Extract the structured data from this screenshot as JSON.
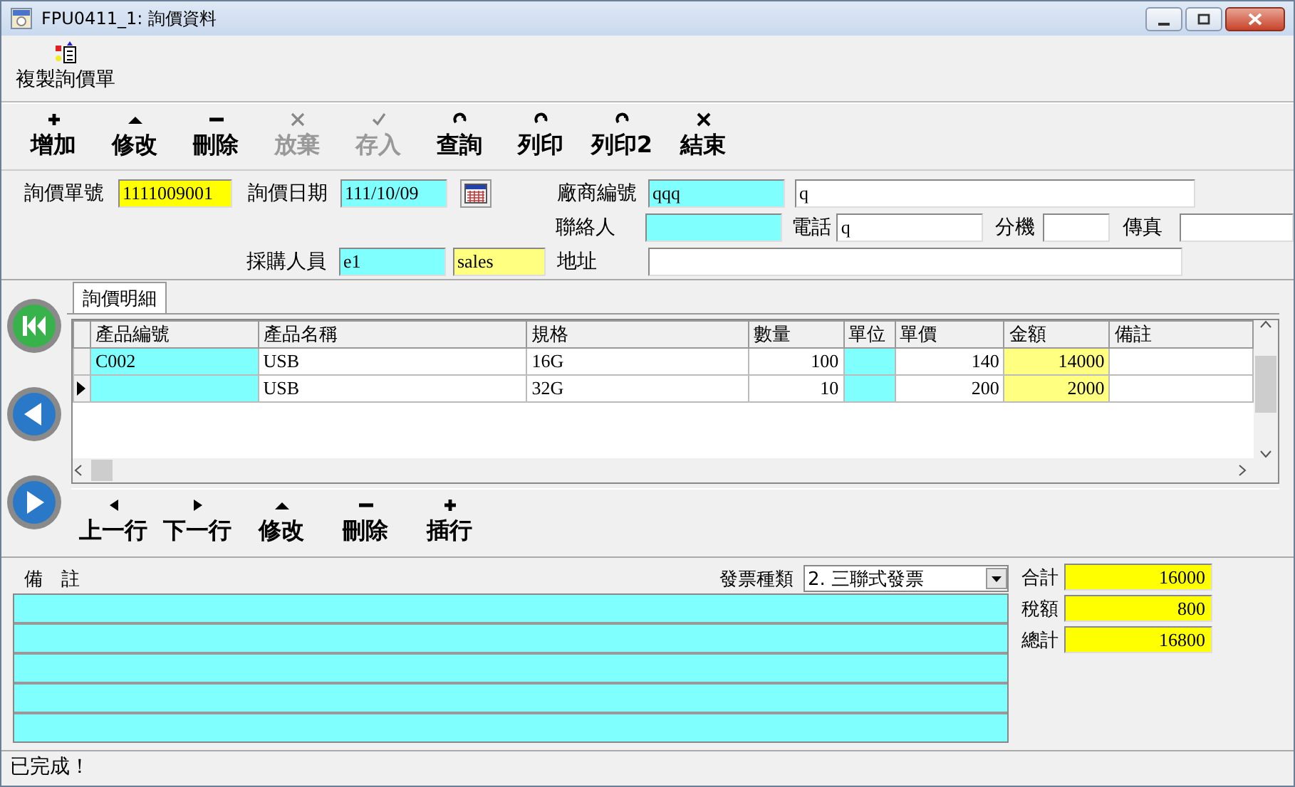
{
  "window": {
    "title": "FPU0411_1: 詢價資料"
  },
  "menu": [
    {
      "label": "複製詢價單"
    }
  ],
  "toolbar": [
    {
      "kind": "add",
      "label": "增加",
      "disabled": false
    },
    {
      "kind": "edit",
      "label": "修改",
      "disabled": false
    },
    {
      "kind": "delete",
      "label": "刪除",
      "disabled": false
    },
    {
      "kind": "cancel",
      "label": "放棄",
      "disabled": true
    },
    {
      "kind": "save",
      "label": "存入",
      "disabled": true
    },
    {
      "kind": "query",
      "label": "查詢",
      "disabled": false
    },
    {
      "kind": "print",
      "label": "列印",
      "disabled": false
    },
    {
      "kind": "print",
      "label": "列印2",
      "disabled": false
    },
    {
      "kind": "exit",
      "label": "結束",
      "disabled": false
    }
  ],
  "header": {
    "quote_no": {
      "label": "詢價單號",
      "value": "1111009001"
    },
    "quote_date": {
      "label": "詢價日期",
      "value": "111/10/09"
    },
    "vendor_code": {
      "label": "廠商編號",
      "value": "qqq"
    },
    "vendor_name": {
      "value": "q"
    },
    "contact": {
      "label": "聯絡人"
    },
    "phone": {
      "label": "電話",
      "value": "q"
    },
    "extension": {
      "label": "分機"
    },
    "fax": {
      "label": "傳真"
    },
    "buyer": {
      "label": "採購人員",
      "value": "e1"
    },
    "buyer_name": {
      "value": "sales"
    },
    "address": {
      "label": "地址"
    }
  },
  "detail": {
    "tabs": [
      {
        "label": "詢價明細",
        "selected": true
      }
    ],
    "columns": [
      "產品編號",
      "產品名稱",
      "規格",
      "數量",
      "單位",
      "單價",
      "金額",
      "備註"
    ],
    "rows": [
      {
        "selected": false,
        "cells": [
          "C002",
          "USB",
          "16G",
          "100",
          null,
          "140",
          "14000",
          null
        ]
      },
      {
        "selected": true,
        "cells": [
          null,
          "USB",
          "32G",
          "10",
          null,
          "200",
          "2000",
          null
        ]
      }
    ],
    "toolbar": [
      {
        "kind": "prev",
        "label": "上一行"
      },
      {
        "kind": "next",
        "label": "下一行"
      },
      {
        "kind": "edit",
        "label": "修改"
      },
      {
        "kind": "delete",
        "label": "刪除"
      },
      {
        "kind": "insert",
        "label": "插行"
      }
    ]
  },
  "footer": {
    "remarks": {
      "label": "備　註"
    },
    "invoice_type": {
      "label": "發票種類",
      "value": "2. 三聯式發票"
    },
    "totals": [
      {
        "label": "合計",
        "value": "16000"
      },
      {
        "label": "稅額",
        "value": "800"
      },
      {
        "label": "總計",
        "value": "16800"
      }
    ]
  },
  "status_bar": "已完成！"
}
